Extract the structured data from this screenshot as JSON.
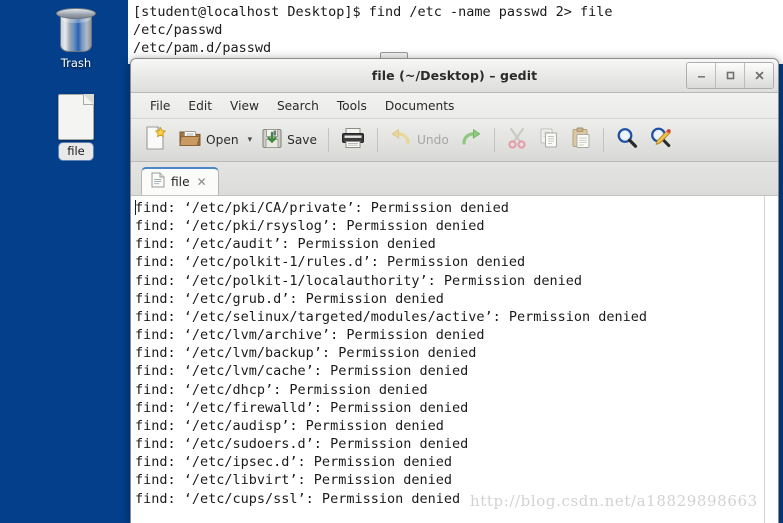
{
  "desktop": {
    "background_color": "#043f8b",
    "icons": [
      {
        "name": "Trash",
        "label": "Trash",
        "icon": "trash-can-icon",
        "selected": false
      },
      {
        "name": "file",
        "label": "file",
        "icon": "text-file-icon",
        "selected": true
      }
    ]
  },
  "terminal": {
    "lines": [
      "[student@localhost Desktop]$ find /etc -name passwd 2> file",
      "/etc/passwd",
      "/etc/pam.d/passwd"
    ],
    "prompt": "[student@localhost Desktop]$",
    "command": "find /etc -name passwd 2> file"
  },
  "gedit": {
    "title": "file (~/Desktop) – gedit",
    "window_buttons": [
      {
        "name": "minimize",
        "glyph": "–"
      },
      {
        "name": "maximize",
        "glyph": "□"
      },
      {
        "name": "close",
        "glyph": "✕"
      }
    ],
    "menubar": [
      {
        "label": "File"
      },
      {
        "label": "Edit"
      },
      {
        "label": "View"
      },
      {
        "label": "Search"
      },
      {
        "label": "Tools"
      },
      {
        "label": "Documents"
      }
    ],
    "toolbar": {
      "new_label": "",
      "open_label": "Open",
      "save_label": "Save",
      "print_label": "",
      "undo_label": "Undo",
      "redo_label": "",
      "items": [
        {
          "name": "new-document-button",
          "icon": "new-document-icon",
          "label": "",
          "enabled": true
        },
        {
          "name": "open-button",
          "icon": "open-folder-icon",
          "label": "Open",
          "enabled": true
        },
        {
          "name": "open-dropdown-button",
          "icon": "chevron-down-icon",
          "label": "",
          "enabled": true
        },
        {
          "name": "save-button",
          "icon": "save-disk-icon",
          "label": "Save",
          "enabled": true
        },
        {
          "name": "print-button",
          "icon": "printer-icon",
          "label": "",
          "enabled": true
        },
        {
          "name": "undo-button",
          "icon": "undo-arrow-icon",
          "label": "Undo",
          "enabled": false
        },
        {
          "name": "redo-button",
          "icon": "redo-arrow-icon",
          "label": "",
          "enabled": true
        },
        {
          "name": "cut-button",
          "icon": "scissors-icon",
          "label": "",
          "enabled": false
        },
        {
          "name": "copy-button",
          "icon": "copy-pages-icon",
          "label": "",
          "enabled": false
        },
        {
          "name": "paste-button",
          "icon": "clipboard-icon",
          "label": "",
          "enabled": false
        },
        {
          "name": "find-button",
          "icon": "magnifier-icon",
          "label": "",
          "enabled": true
        },
        {
          "name": "replace-button",
          "icon": "find-replace-icon",
          "label": "",
          "enabled": true
        }
      ]
    },
    "tab": {
      "label": "file",
      "close_glyph": "✕",
      "icon": "text-file-icon",
      "active": true
    },
    "document": {
      "text": "find: ‘/etc/pki/CA/private’: Permission denied\nfind: ‘/etc/pki/rsyslog’: Permission denied\nfind: ‘/etc/audit’: Permission denied\nfind: ‘/etc/polkit-1/rules.d’: Permission denied\nfind: ‘/etc/polkit-1/localauthority’: Permission denied\nfind: ‘/etc/grub.d’: Permission denied\nfind: ‘/etc/selinux/targeted/modules/active’: Permission denied\nfind: ‘/etc/lvm/archive’: Permission denied\nfind: ‘/etc/lvm/backup’: Permission denied\nfind: ‘/etc/lvm/cache’: Permission denied\nfind: ‘/etc/dhcp’: Permission denied\nfind: ‘/etc/firewalld’: Permission denied\nfind: ‘/etc/audisp’: Permission denied\nfind: ‘/etc/sudoers.d’: Permission denied\nfind: ‘/etc/ipsec.d’: Permission denied\nfind: ‘/etc/libvirt’: Permission denied\nfind: ‘/etc/cups/ssl’: Permission denied",
      "lines": [
        "find: ‘/etc/pki/CA/private’: Permission denied",
        "find: ‘/etc/pki/rsyslog’: Permission denied",
        "find: ‘/etc/audit’: Permission denied",
        "find: ‘/etc/polkit-1/rules.d’: Permission denied",
        "find: ‘/etc/polkit-1/localauthority’: Permission denied",
        "find: ‘/etc/grub.d’: Permission denied",
        "find: ‘/etc/selinux/targeted/modules/active’: Permission denied",
        "find: ‘/etc/lvm/archive’: Permission denied",
        "find: ‘/etc/lvm/backup’: Permission denied",
        "find: ‘/etc/lvm/cache’: Permission denied",
        "find: ‘/etc/dhcp’: Permission denied",
        "find: ‘/etc/firewalld’: Permission denied",
        "find: ‘/etc/audisp’: Permission denied",
        "find: ‘/etc/sudoers.d’: Permission denied",
        "find: ‘/etc/ipsec.d’: Permission denied",
        "find: ‘/etc/libvirt’: Permission denied",
        "find: ‘/etc/cups/ssl’: Permission denied"
      ]
    }
  },
  "watermark": {
    "text": "http://blog.csdn.net/a18829898663"
  }
}
